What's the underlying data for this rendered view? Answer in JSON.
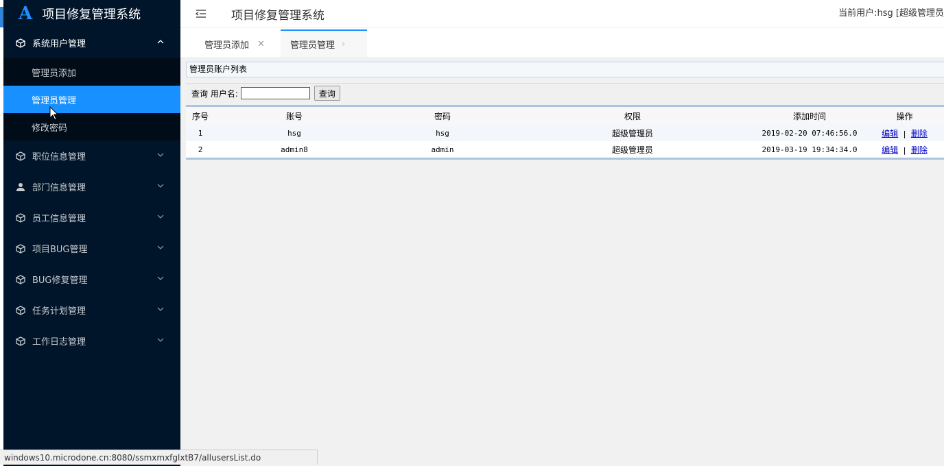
{
  "app": {
    "logo_text": "A",
    "title": "项目修复管理系统"
  },
  "header": {
    "title": "项目修复管理系统",
    "user_info": "当前用户:hsg [超级管理员"
  },
  "sidebar": {
    "groups": [
      {
        "label": "系统用户管理",
        "icon": "cube-icon",
        "open": true,
        "items": [
          {
            "label": "管理员添加"
          },
          {
            "label": "管理员管理",
            "active": true
          },
          {
            "label": "修改密码"
          }
        ]
      },
      {
        "label": "职位信息管理",
        "icon": "cube-icon"
      },
      {
        "label": "部门信息管理",
        "icon": "user-icon"
      },
      {
        "label": "员工信息管理",
        "icon": "cube-icon"
      },
      {
        "label": "项目BUG管理",
        "icon": "cube-icon"
      },
      {
        "label": "BUG修复管理",
        "icon": "cube-icon"
      },
      {
        "label": "任务计划管理",
        "icon": "cube-icon"
      },
      {
        "label": "工作日志管理",
        "icon": "cube-icon"
      }
    ]
  },
  "tabs": [
    {
      "label": "管理员添加",
      "close": "✕"
    },
    {
      "label": "管理员管理",
      "close": "›",
      "active": true
    }
  ],
  "main": {
    "panel_title": "管理员账户列表",
    "search": {
      "label": "查询 用户名:",
      "value": "",
      "button": "查询"
    },
    "table": {
      "headers": [
        "序号",
        "账号",
        "密码",
        "权限",
        "添加时间",
        "操作"
      ],
      "rows": [
        {
          "no": "1",
          "account": "hsg",
          "password": "hsg",
          "role": "超级管理员",
          "time": "2019-02-20 07:46:56.0",
          "edit": "编辑",
          "sep": "|",
          "delete": "删除"
        },
        {
          "no": "2",
          "account": "admin8",
          "password": "admin",
          "role": "超级管理员",
          "time": "2019-03-19 19:34:34.0",
          "edit": "编辑",
          "sep": "|",
          "delete": "删除"
        }
      ]
    }
  },
  "statusbar": {
    "url": "windows10.microdone.cn:8080/ssmxmxfglxtB7/allusersList.do"
  },
  "colors": {
    "sidebar_bg": "#001529",
    "active_bg": "#1890ff",
    "accent": "#1e90ff"
  }
}
